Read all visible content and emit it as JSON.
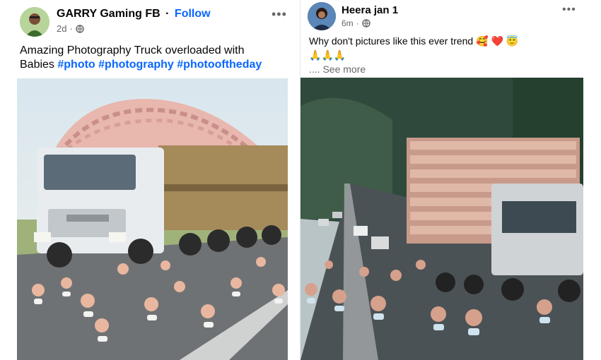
{
  "left_post": {
    "author": "GARRY Gaming FB",
    "separator": "·",
    "follow_label": "Follow",
    "time": "2d",
    "meta_separator": "·",
    "caption_line1": "Amazing Photography Truck overloaded with",
    "caption_line2_prefix": "Babies",
    "hashtags": [
      "#photo",
      "#photography",
      "#photooftheday"
    ],
    "more_icon": "more-horizontal-icon",
    "audience_icon": "globe-icon"
  },
  "right_post": {
    "author": "Heera jan 1",
    "time": "6m",
    "meta_separator": "·",
    "caption_text": "Why don't pictures like this ever trend",
    "caption_emoji": [
      "🥰",
      "❤️",
      "😇"
    ],
    "caption_line2_emoji": [
      "🙏",
      "🙏",
      "🙏"
    ],
    "see_more_prefix": "....",
    "see_more_label": "See more",
    "more_icon": "more-horizontal-icon",
    "audience_icon": "globe-icon"
  },
  "colors": {
    "link_blue": "#0866ff",
    "secondary_text": "#65676b",
    "primary_text": "#050505"
  }
}
